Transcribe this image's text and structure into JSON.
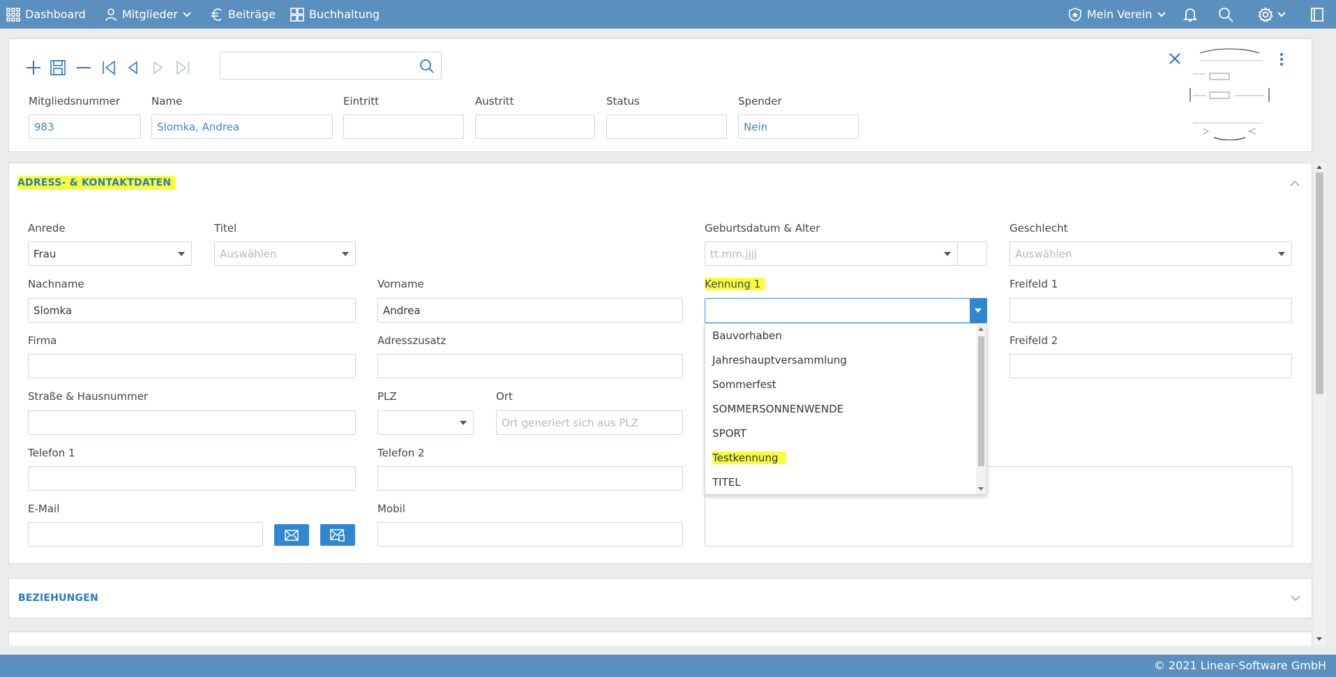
{
  "nav": {
    "dashboard": "Dashboard",
    "mitglieder": "Mitglieder",
    "beitraege": "Beiträge",
    "buchhaltung": "Buchhaltung",
    "mein_verein": "Mein Verein"
  },
  "header": {
    "search": {
      "value": "",
      "placeholder": ""
    },
    "fields": {
      "mitgliedsnummer": {
        "label": "Mitgliedsnummer",
        "value": "983"
      },
      "name": {
        "label": "Name",
        "value": "Slomka, Andrea"
      },
      "eintritt": {
        "label": "Eintritt",
        "value": ""
      },
      "austritt": {
        "label": "Austritt",
        "value": ""
      },
      "status": {
        "label": "Status",
        "value": ""
      },
      "spender": {
        "label": "Spender",
        "value": "Nein"
      }
    }
  },
  "address": {
    "title": "ADRESS- & KONTAKTDATEN",
    "anrede": {
      "label": "Anrede",
      "value": "Frau"
    },
    "titel": {
      "label": "Titel",
      "placeholder": "Auswählen"
    },
    "geburtsdatum": {
      "label": "Geburtsdatum & Alter",
      "placeholder": "tt.mm.jjjj",
      "age": ""
    },
    "geschlecht": {
      "label": "Geschlecht",
      "placeholder": "Auswählen"
    },
    "nachname": {
      "label": "Nachname",
      "value": "Slomka"
    },
    "vorname": {
      "label": "Vorname",
      "value": "Andrea"
    },
    "kennung1": {
      "label": "Kennung 1",
      "value": "",
      "options": [
        "Bauvorhaben",
        "Jahreshauptversammlung",
        "Sommerfest",
        "SOMMERSONNENWENDE",
        "SPORT",
        "Testkennung",
        "TITEL"
      ],
      "highlighted": "Testkennung"
    },
    "freifeld1": {
      "label": "Freifeld 1",
      "value": ""
    },
    "firma": {
      "label": "Firma",
      "value": ""
    },
    "adresszusatz": {
      "label": "Adresszusatz",
      "value": ""
    },
    "freifeld2": {
      "label": "Freifeld 2",
      "value": ""
    },
    "strasse": {
      "label": "Straße & Hausnummer",
      "value": ""
    },
    "plz": {
      "label": "PLZ",
      "value": ""
    },
    "ort": {
      "label": "Ort",
      "placeholder": "Ort generiert sich aus PLZ"
    },
    "telefon1": {
      "label": "Telefon 1",
      "value": ""
    },
    "telefon2": {
      "label": "Telefon 2",
      "value": ""
    },
    "email": {
      "label": "E-Mail",
      "value": ""
    },
    "mobil": {
      "label": "Mobil",
      "value": ""
    }
  },
  "relations": {
    "title": "BEZIEHUNGEN"
  },
  "footer": {
    "copyright": "© 2021 Linear-Software GmbH"
  },
  "colors": {
    "topbar": "#5b8fbd",
    "accent": "#2c78c0",
    "button": "#2f87d0",
    "highlight": "#f7ff3a"
  }
}
